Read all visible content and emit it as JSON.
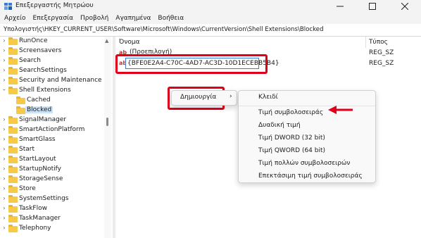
{
  "window": {
    "title": "Επεξεργαστής Μητρώου"
  },
  "menu": [
    "Αρχείο",
    "Επεξεργασία",
    "Προβολή",
    "Αγαπημένα",
    "Βοήθεια"
  ],
  "address": "Υπολογιστής\\HKEY_CURRENT_USER\\Software\\Microsoft\\Windows\\CurrentVersion\\Shell Extensions\\Blocked",
  "tree": [
    {
      "label": "RunOnce"
    },
    {
      "label": "Screensavers"
    },
    {
      "label": "Search"
    },
    {
      "label": "SearchSettings"
    },
    {
      "label": "Security and Maintenance"
    },
    {
      "label": "Shell Extensions"
    },
    {
      "label": "Cached"
    },
    {
      "label": "Blocked"
    },
    {
      "label": "SignalManager"
    },
    {
      "label": "SmartActionPlatform"
    },
    {
      "label": "SmartGlass"
    },
    {
      "label": "Start"
    },
    {
      "label": "StartLayout"
    },
    {
      "label": "StartupNotify"
    },
    {
      "label": "StorageSense"
    },
    {
      "label": "Store"
    },
    {
      "label": "SystemSettings"
    },
    {
      "label": "TaskFlow"
    },
    {
      "label": "TaskManager"
    },
    {
      "label": "Telephony"
    }
  ],
  "values": {
    "col_name": "Όνομα",
    "col_type": "Τύπος",
    "rows": [
      {
        "name": "(Προεπιλογή)",
        "type": "REG_SZ"
      },
      {
        "name": "{BFE0E2A4-C70C-4AD7-AC3D-10D1ECEBB5B4}",
        "type": "REG_SZ"
      }
    ]
  },
  "context_menu": {
    "new_label": "Δημιουργία",
    "new_chevron": "›"
  },
  "submenu": [
    "Κλειδί",
    "Τιμή συμβολοσειράς",
    "Δυαδική τιμή",
    "Τιμή DWORD (32 bit)",
    "Τιμή QWORD (64 bit)",
    "Τιμή πολλών συμβολοσειρών",
    "Επεκτάσιμη τιμή συμβολοσειράς"
  ],
  "colors": {
    "highlight": "#e0001a",
    "accent": "#3b78d8",
    "selection": "#cce4f7",
    "folder": "#f7c948"
  }
}
